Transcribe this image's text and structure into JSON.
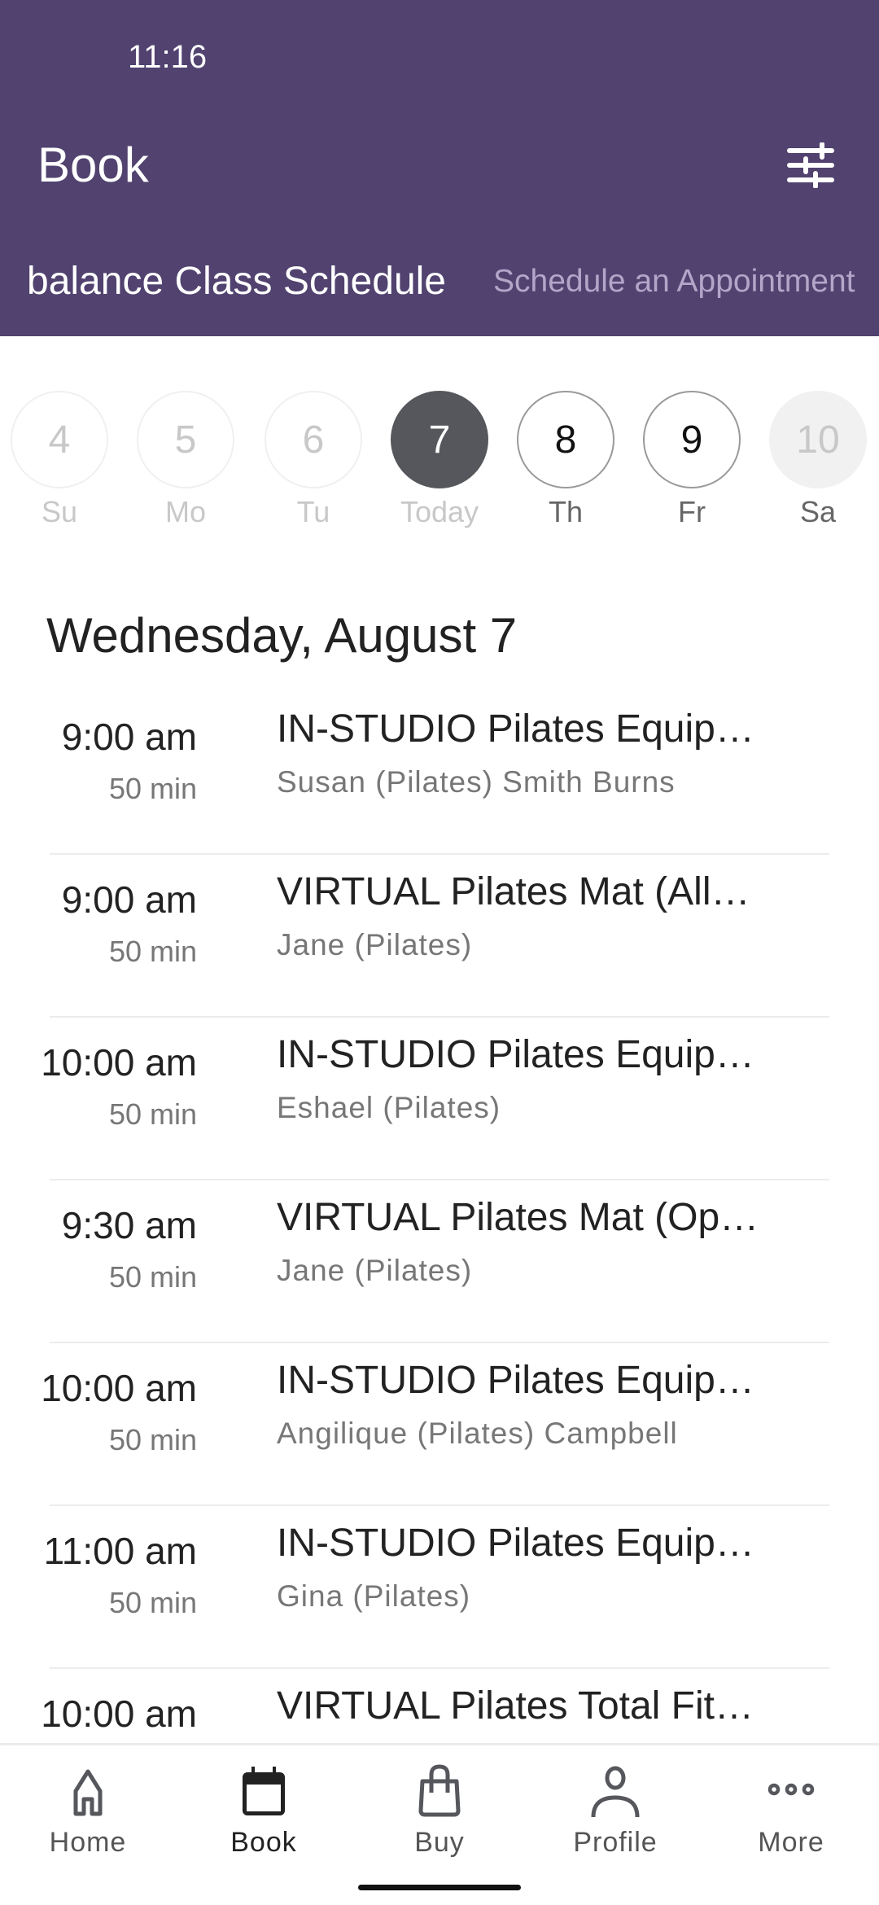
{
  "status_bar": {
    "time": "11:16"
  },
  "header": {
    "title": "Book",
    "filter_icon": "sliders-icon"
  },
  "tabs": [
    {
      "label": "balance Class Schedule",
      "active": true
    },
    {
      "label": "Schedule an Appointment",
      "active": false
    }
  ],
  "days": [
    {
      "num": "4",
      "label": "Su",
      "state": "past"
    },
    {
      "num": "5",
      "label": "Mo",
      "state": "past"
    },
    {
      "num": "6",
      "label": "Tu",
      "state": "past"
    },
    {
      "num": "7",
      "label": "Today",
      "state": "selected"
    },
    {
      "num": "8",
      "label": "Th",
      "state": "future"
    },
    {
      "num": "9",
      "label": "Fr",
      "state": "future"
    },
    {
      "num": "10",
      "label": "Sa",
      "state": "unavailable"
    }
  ],
  "date_heading": "Wednesday, August 7",
  "classes": [
    {
      "time": "9:00 am",
      "duration": "50 min",
      "title": "IN-STUDIO Pilates Equip…",
      "instructor": "Susan (Pilates) Smith Burns"
    },
    {
      "time": "9:00 am",
      "duration": "50 min",
      "title": "VIRTUAL Pilates Mat (All…",
      "instructor": "Jane (Pilates)"
    },
    {
      "time": "10:00 am",
      "duration": "50 min",
      "title": "IN-STUDIO Pilates Equip…",
      "instructor": "Eshael (Pilates)"
    },
    {
      "time": "9:30 am",
      "duration": "50 min",
      "title": "VIRTUAL Pilates Mat (Op…",
      "instructor": "Jane (Pilates)"
    },
    {
      "time": "10:00 am",
      "duration": "50 min",
      "title": "IN-STUDIO Pilates Equip…",
      "instructor": "Angilique (Pilates) Campbell"
    },
    {
      "time": "11:00 am",
      "duration": "50 min",
      "title": "IN-STUDIO Pilates Equip…",
      "instructor": "Gina (Pilates)"
    },
    {
      "time": "10:00 am",
      "duration": "",
      "title": "VIRTUAL Pilates Total Fit…",
      "instructor": ""
    }
  ],
  "nav": [
    {
      "label": "Home",
      "icon": "home-icon"
    },
    {
      "label": "Book",
      "icon": "calendar-icon",
      "active": true
    },
    {
      "label": "Buy",
      "icon": "shopping-bag-icon"
    },
    {
      "label": "Profile",
      "icon": "person-icon"
    },
    {
      "label": "More",
      "icon": "more-icon"
    }
  ],
  "colors": {
    "header": "#51426f",
    "selected_day": "#55575c"
  }
}
